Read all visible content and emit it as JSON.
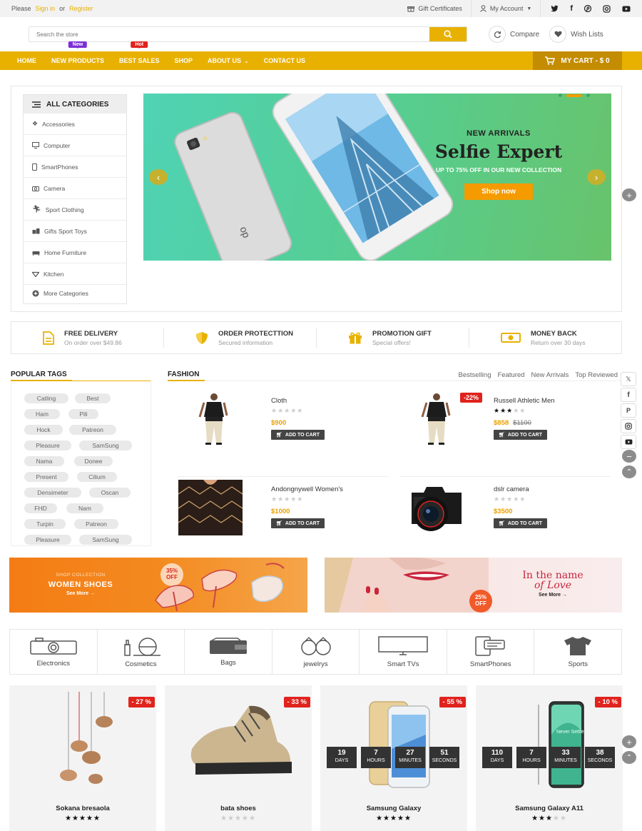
{
  "topbar": {
    "please": "Please",
    "sign_in": "Sign in",
    "or": "or",
    "register": "Register",
    "gift": "Gift Certificates",
    "account": "My Account"
  },
  "header": {
    "search_placeholder": "Search the store",
    "compare": "Compare",
    "wishlists": "Wish Lists"
  },
  "nav": {
    "items": [
      "HOME",
      "NEW PRODUCTS",
      "BEST SALES",
      "SHOP",
      "ABOUT US",
      "CONTACT US"
    ],
    "badge_new": "New",
    "badge_hot": "Hot",
    "cart": "MY CART - $ 0"
  },
  "categories": {
    "title": "ALL CATEGORIES",
    "items": [
      "Accessories",
      "Computer",
      "SmartPhones",
      "Camera",
      "Sport Clothing",
      "Gifts Sport Toys",
      "Home Furniture",
      "Kitchen",
      "More Categories"
    ]
  },
  "slider": {
    "kicker": "NEW ARRIVALS",
    "title": "Selfie Expert",
    "subtitle": "UP TO 75% OFF IN OUR NEW COLLECTION",
    "button": "Shop now",
    "phone_brand": "op"
  },
  "features": [
    {
      "title": "FREE DELIVERY",
      "sub": "On order over $49.86"
    },
    {
      "title": "ORDER PROTECTTION",
      "sub": "Secured information"
    },
    {
      "title": "PROMOTION GIFT",
      "sub": "Special offers!"
    },
    {
      "title": "MONEY BACK",
      "sub": "Return over 30 days"
    }
  ],
  "tags": {
    "title": "POPULAR TAGS",
    "items": [
      "Catling",
      "Best",
      "Ham",
      "Pili",
      "Hock",
      "Patreon",
      "Pleasure",
      "SamSung",
      "Nama",
      "Donee",
      "Present",
      "Cilium",
      "Densimeter",
      "Oscan",
      "FHD",
      "Nam",
      "Turpin",
      "Patreon",
      "Pleasure",
      "SamSung"
    ]
  },
  "fashion": {
    "title": "FASHION",
    "tabs": [
      "Bestselling",
      "Featured",
      "New Arrivals",
      "Top Reviewed"
    ],
    "add_to_cart": "ADD TO CART",
    "products": [
      {
        "name": "Cloth",
        "price": "$900",
        "old": "",
        "rating": 0,
        "discount": ""
      },
      {
        "name": "Russell Athletic Men",
        "price": "$858",
        "old": "$1100",
        "rating": 3,
        "discount": "-22%"
      },
      {
        "name": "Andongnywell Women's",
        "price": "$1000",
        "old": "",
        "rating": 0,
        "discount": ""
      },
      {
        "name": "dslr camera",
        "price": "$3500",
        "old": "",
        "rating": 0,
        "discount": ""
      }
    ]
  },
  "banners": {
    "left": {
      "kicker": "SHOP COLLECTION",
      "title": "WOMEN SHOES",
      "link": "See More",
      "badge_pct": "35%",
      "badge_off": "OFF"
    },
    "right": {
      "title1": "In the name",
      "title2": "of Love",
      "link": "See More",
      "badge_pct": "25%",
      "badge_off": "OFF"
    }
  },
  "icon_categories": [
    "Electronics",
    "Cosmetics",
    "Bags",
    "jewelrys",
    "Smart TVs",
    "SmartPhones",
    "Sports"
  ],
  "products": [
    {
      "name": "Sokana bresaola",
      "discount": "- 27 %",
      "rating": 5,
      "countdown": null
    },
    {
      "name": "bata shoes",
      "discount": "- 33 %",
      "rating": 0,
      "countdown": null
    },
    {
      "name": "Samsung Galaxy",
      "discount": "- 55 %",
      "rating": 5,
      "countdown": [
        {
          "n": "19",
          "l": "DAYS"
        },
        {
          "n": "7",
          "l": "HOURS"
        },
        {
          "n": "27",
          "l": "MINUTES"
        },
        {
          "n": "51",
          "l": "SECONDS"
        }
      ]
    },
    {
      "name": "Samsung Galaxy A11",
      "discount": "- 10 %",
      "rating": 3,
      "countdown": [
        {
          "n": "110",
          "l": "DAYS"
        },
        {
          "n": "7",
          "l": "HOURS"
        },
        {
          "n": "33",
          "l": "MINUTES"
        },
        {
          "n": "38",
          "l": "SECONDS"
        }
      ],
      "phone_text": "Never Settle"
    }
  ],
  "colors": {
    "accent": "#e8b100",
    "dark_accent": "#c48c00",
    "badge_new": "#7b2fd6",
    "sale": "#e0231d"
  }
}
